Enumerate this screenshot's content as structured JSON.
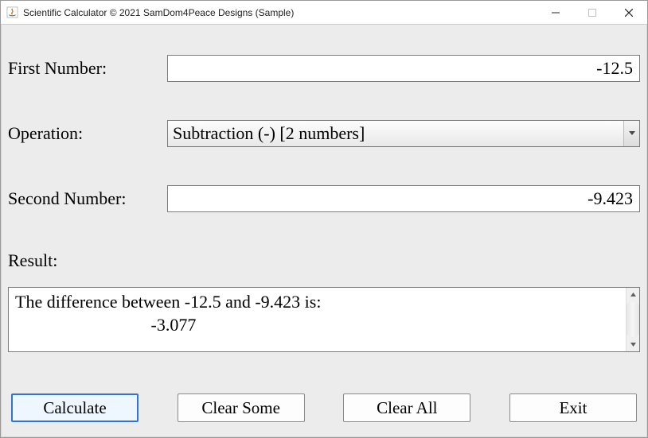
{
  "window": {
    "title": "Scientific Calculator © 2021 SamDom4Peace Designs (Sample)"
  },
  "labels": {
    "first_number": "First Number:",
    "operation": "Operation:",
    "second_number": "Second Number:",
    "result": "Result:"
  },
  "fields": {
    "first_number_value": "-12.5",
    "operation_selected": "Subtraction (-) [2 numbers]",
    "second_number_value": "-9.423",
    "result_text": "The difference between -12.5 and -9.423 is:\n                               -3.077"
  },
  "buttons": {
    "calculate": "Calculate",
    "clear_some": "Clear Some",
    "clear_all": "Clear All",
    "exit": "Exit"
  }
}
